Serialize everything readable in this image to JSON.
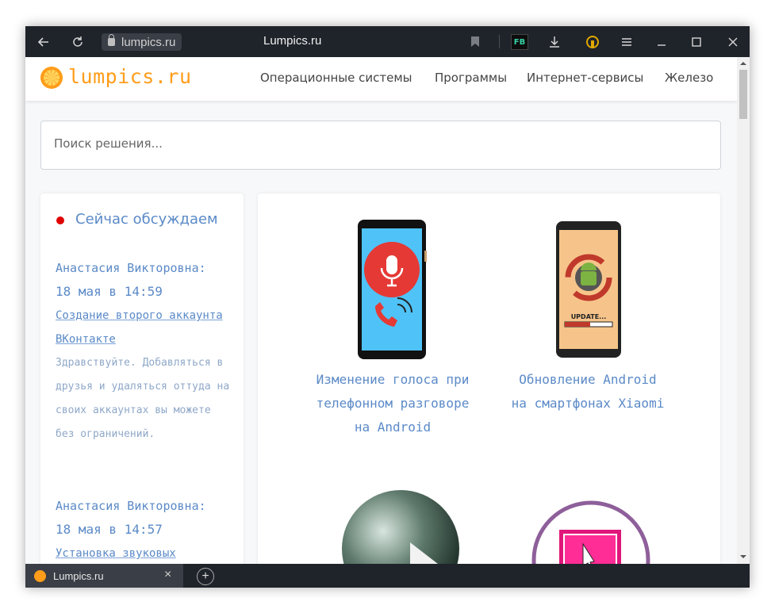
{
  "browser": {
    "url": "lumpics.ru",
    "page_title": "Lumpics.ru",
    "extension_label": "FB",
    "tab_title": "Lumpics.ru",
    "tab_close": "×",
    "new_tab": "+"
  },
  "header": {
    "logo": "lumpics.ru",
    "nav": [
      "Операционные системы",
      "Программы",
      "Интернет-сервисы",
      "Железо"
    ]
  },
  "search": {
    "placeholder": "Поиск решения..."
  },
  "sidebar": {
    "title": "Сейчас обсуждаем",
    "comments": [
      {
        "author": "Анастасия Викторовна:",
        "date": "18 мая в 14:59",
        "link": "Создание второго аккаунта ВКонтакте",
        "text": "Здравствуйте. Добавляться в друзья и удаляться оттуда на своих аккаунтах вы можете без ограничений."
      },
      {
        "author": "Анастасия Викторовна:",
        "date": "18 мая в 14:57",
        "link": "Установка звуковых",
        "text": ""
      }
    ]
  },
  "articles": [
    {
      "title": "Изменение голоса при телефонном разговоре на Android"
    },
    {
      "title": "Обновление Android на смартфонах Xiaomi",
      "image_caption": "UPDATE..."
    },
    {
      "title": ""
    },
    {
      "title": ""
    }
  ],
  "colors": {
    "accent": "#ff9d1a",
    "link": "#5b8ac7",
    "chrome": "#1f232a",
    "indicator": "#e00000"
  }
}
